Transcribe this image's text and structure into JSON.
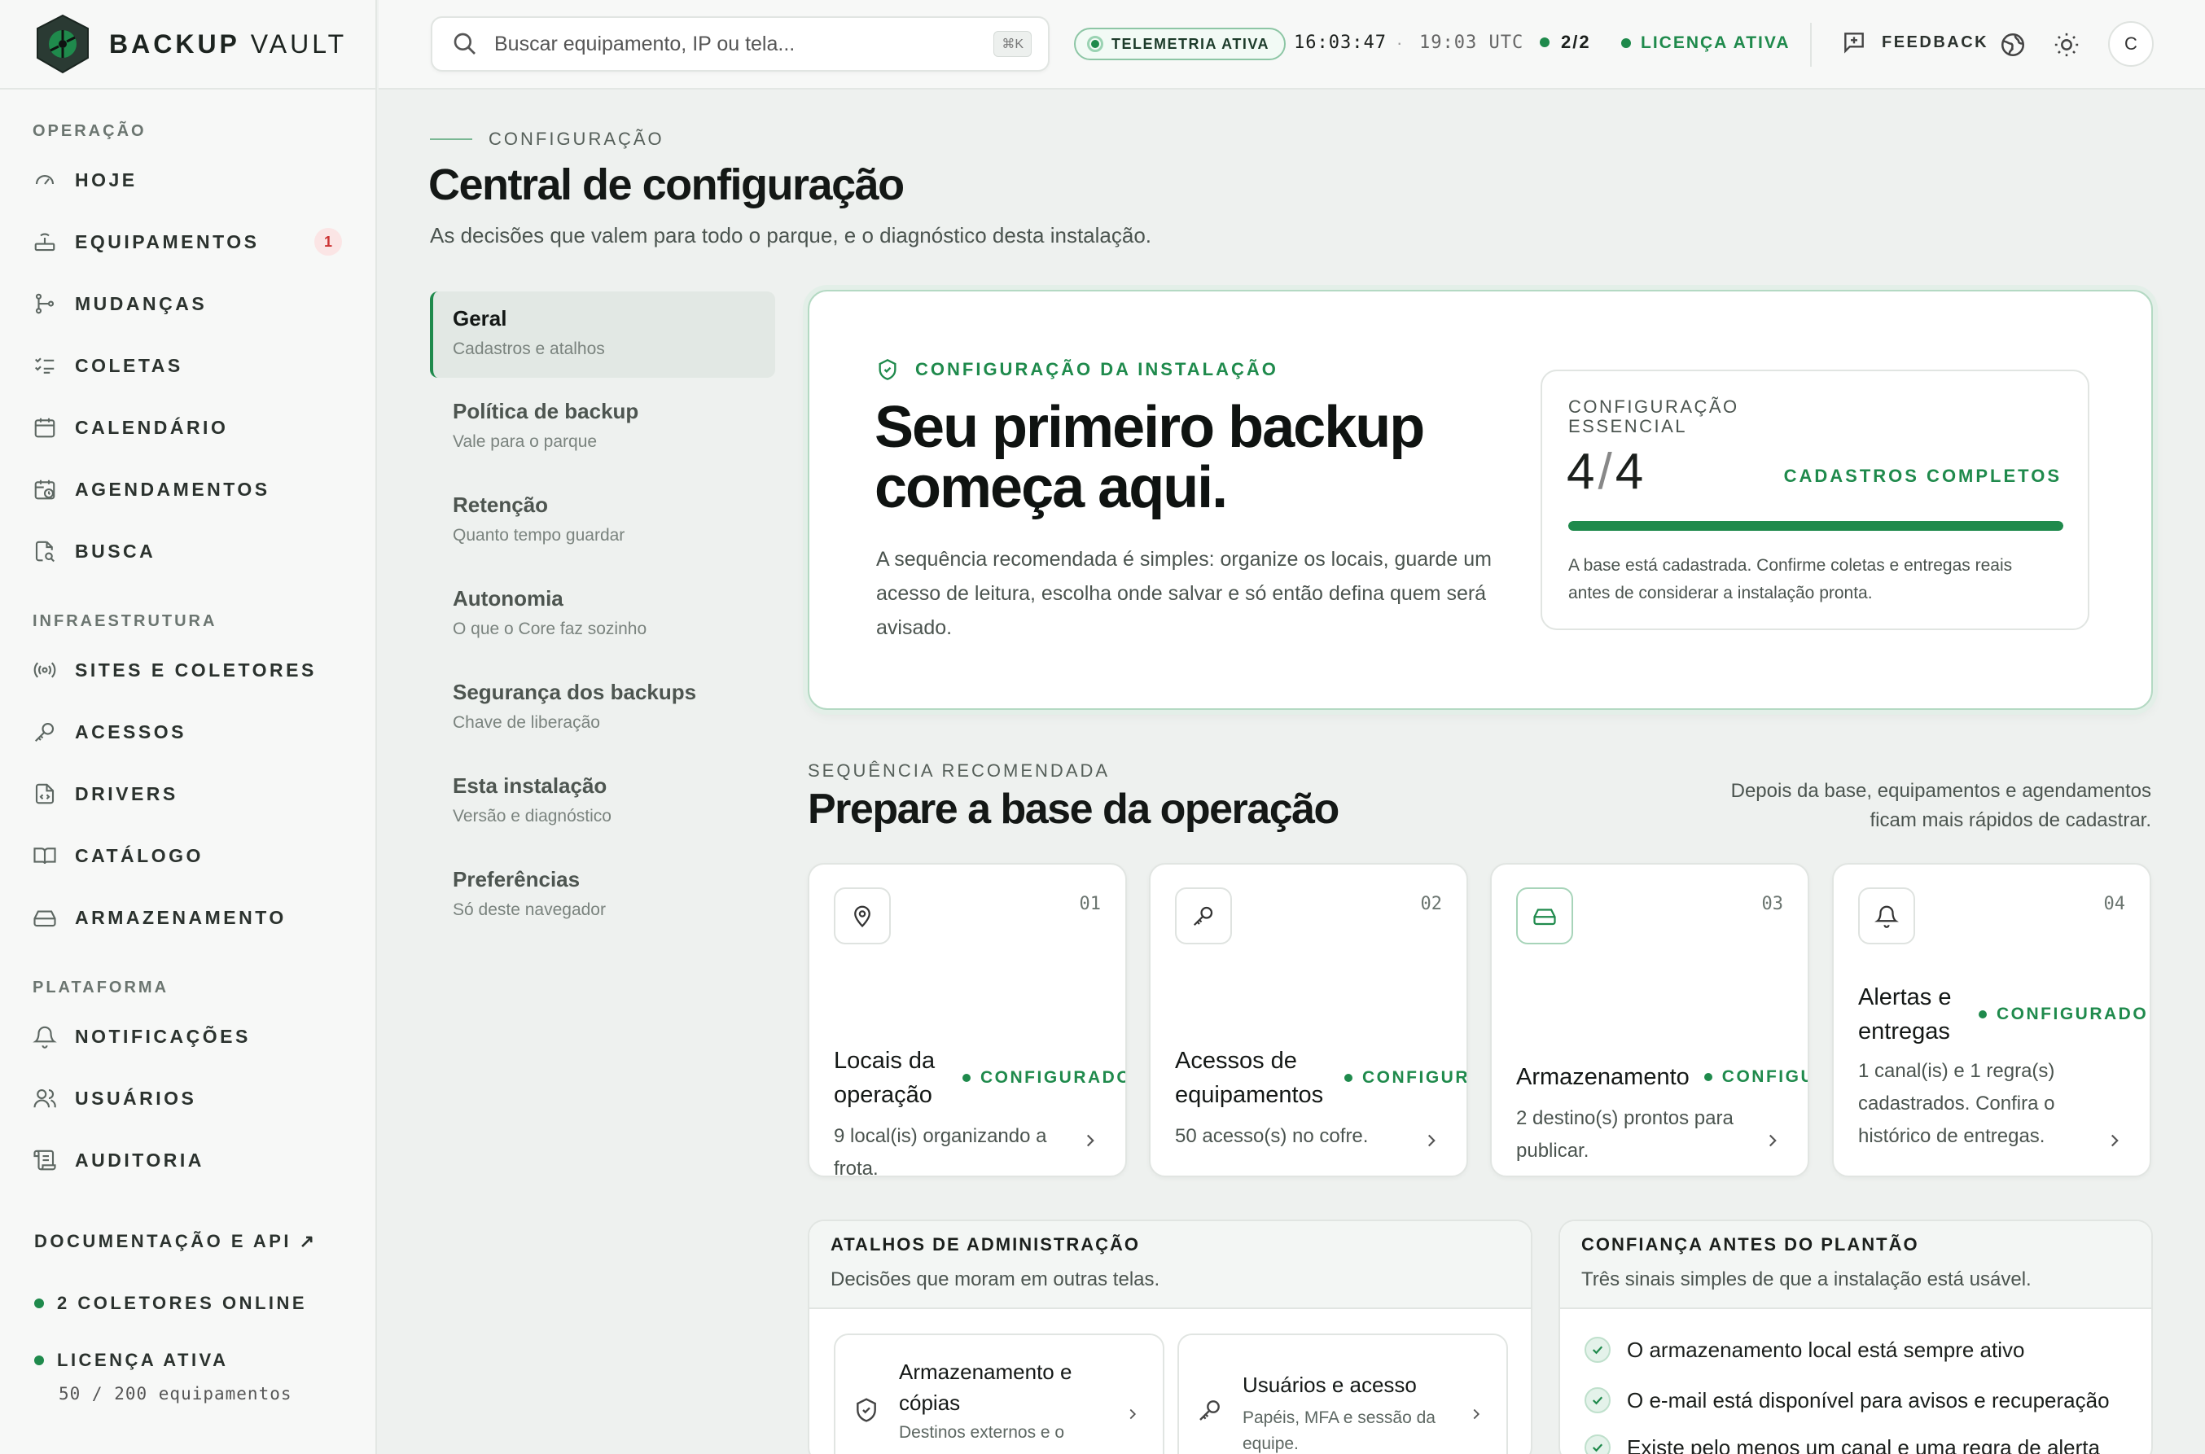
{
  "brand": {
    "bold": "BACKUP",
    "light": "VAULT"
  },
  "sidebar": {
    "sections": [
      "OPERAÇÃO",
      "INFRAESTRUTURA",
      "PLATAFORMA"
    ],
    "items": [
      {
        "label": "HOJE",
        "icon": "gauge-icon"
      },
      {
        "label": "EQUIPAMENTOS",
        "icon": "router-icon",
        "badge": "1"
      },
      {
        "label": "MUDANÇAS",
        "icon": "git-branch-icon"
      },
      {
        "label": "COLETAS",
        "icon": "checklist-icon"
      },
      {
        "label": "CALENDÁRIO",
        "icon": "calendar-icon"
      },
      {
        "label": "AGENDAMENTOS",
        "icon": "calendar-clock-icon"
      },
      {
        "label": "BUSCA",
        "icon": "file-search-icon"
      },
      {
        "label": "SITES E COLETORES",
        "icon": "radio-icon"
      },
      {
        "label": "ACESSOS",
        "icon": "key-icon"
      },
      {
        "label": "DRIVERS",
        "icon": "file-code-icon"
      },
      {
        "label": "CATÁLOGO",
        "icon": "book-icon"
      },
      {
        "label": "ARMAZENAMENTO",
        "icon": "hard-drive-icon"
      },
      {
        "label": "NOTIFICAÇÕES",
        "icon": "bell-icon"
      },
      {
        "label": "USUÁRIOS",
        "icon": "users-icon"
      },
      {
        "label": "AUDITORIA",
        "icon": "scroll-icon"
      }
    ],
    "docs": "DOCUMENTAÇÃO E API ↗",
    "collectors": "2 COLETORES ONLINE",
    "license": "LICENÇA ATIVA",
    "license_usage": "50 / 200 equipamentos"
  },
  "topbar": {
    "search_placeholder": "Buscar equipamento, IP ou tela...",
    "search_shortcut": "⌘K",
    "telemetry": "TELEMETRIA ATIVA",
    "clock": "16:03:47",
    "separator": "·",
    "utc": "19:03 UTC",
    "collectors_count": "2/2",
    "license": "LICENÇA ATIVA",
    "feedback": "FEEDBACK",
    "avatar": "C"
  },
  "page": {
    "eyebrow": "CONFIGURAÇÃO",
    "title": "Central de configuração",
    "subtitle": "As decisões que valem para todo o parque, e o diagnóstico desta instalação."
  },
  "settings_nav": [
    {
      "title": "Geral",
      "sub": "Cadastros e atalhos"
    },
    {
      "title": "Política de backup",
      "sub": "Vale para o parque"
    },
    {
      "title": "Retenção",
      "sub": "Quanto tempo guardar"
    },
    {
      "title": "Autonomia",
      "sub": "O que o Core faz sozinho"
    },
    {
      "title": "Segurança dos backups",
      "sub": "Chave de liberação"
    },
    {
      "title": "Esta instalação",
      "sub": "Versão e diagnóstico"
    },
    {
      "title": "Preferências",
      "sub": "Só deste navegador"
    }
  ],
  "hero": {
    "tag": "CONFIGURAÇÃO DA INSTALAÇÃO",
    "title": "Seu primeiro backup começa aqui.",
    "body": "A sequência recomendada é simples: organize os locais, guarde um acesso de leitura, escolha onde salvar e só então defina quem será avisado.",
    "essential": {
      "label": "CONFIGURAÇÃO ESSENCIAL",
      "done": "4",
      "slash": "/",
      "total": "4",
      "progress": 1.0,
      "status": "CADASTROS COMPLETOS",
      "note": "A base está cadastrada. Confirme coletas e entregas reais antes de considerar a instalação pronta."
    }
  },
  "sequence": {
    "eyebrow": "SEQUÊNCIA RECOMENDADA",
    "title": "Prepare a base da operação",
    "note": "Depois da base, equipamentos e agendamentos ficam mais rápidos de cadastrar.",
    "steps": [
      {
        "num": "01",
        "name": "Locais da operação",
        "status": "CONFIGURADO",
        "desc": "9 local(is) organizando a frota.",
        "icon": "map-pin-icon"
      },
      {
        "num": "02",
        "name": "Acessos de equipamentos",
        "status": "CONFIGURADO",
        "desc": "50 acesso(s) no cofre.",
        "icon": "key-icon"
      },
      {
        "num": "03",
        "name": "Armazenamento",
        "status": "CONFIGURADO",
        "desc": "2 destino(s) prontos para publicar.",
        "icon": "hard-drive-icon"
      },
      {
        "num": "04",
        "name": "Alertas e entregas",
        "status": "CONFIGURADO",
        "desc": "1 canal(is) e 1 regra(s) cadastrados. Confira o histórico de entregas.",
        "icon": "bell-icon"
      }
    ]
  },
  "admin_shortcuts": {
    "title": "ATALHOS DE ADMINISTRAÇÃO",
    "subtitle": "Decisões que moram em outras telas.",
    "items": [
      {
        "title": "Armazenamento e cópias",
        "sub": "Destinos externos e o"
      },
      {
        "title": "Usuários e acesso",
        "sub": "Papéis, MFA e sessão da equipe."
      }
    ]
  },
  "trust": {
    "title": "CONFIANÇA ANTES DO PLANTÃO",
    "subtitle": "Três sinais simples de que a instalação está usável.",
    "checks": [
      "O armazenamento local está sempre ativo",
      "O e-mail está disponível para avisos e recuperação",
      "Existe pelo menos um canal e uma regra de alerta"
    ]
  },
  "colors": {
    "accent": "#1f8a4c",
    "accent_light": "#e4f2ea",
    "badge_red": "#cc3333"
  }
}
